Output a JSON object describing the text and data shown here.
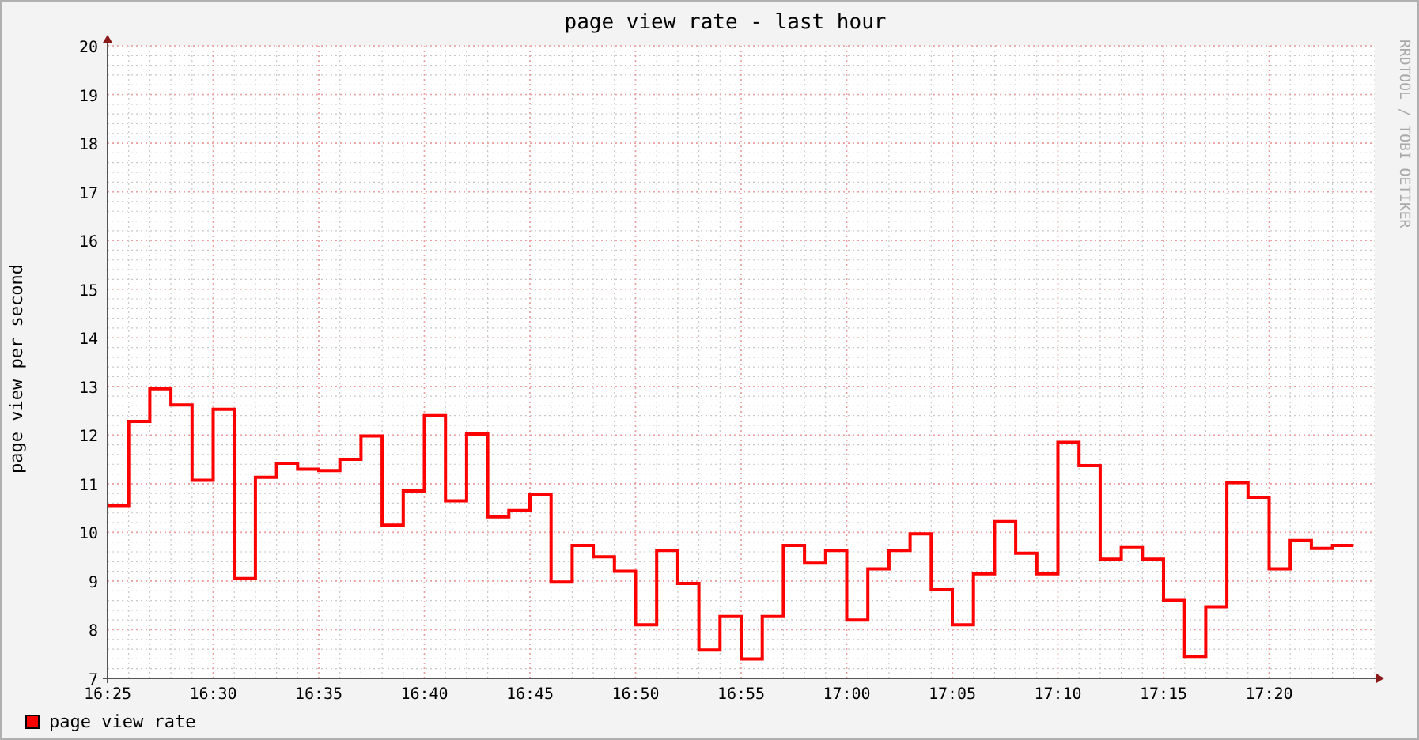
{
  "chart": {
    "chart_data": {
      "type": "line",
      "title": "page view rate - last hour",
      "ylabel": "page view per second",
      "x": [
        985,
        986,
        986,
        987,
        987,
        988,
        988,
        989,
        989,
        990,
        990,
        991,
        991,
        992,
        992,
        993,
        993,
        994,
        994,
        995,
        995,
        996,
        996,
        997,
        997,
        998,
        998,
        999,
        999,
        1000,
        1000,
        1001,
        1001,
        1002,
        1002,
        1003,
        1003,
        1004,
        1004,
        1005,
        1005,
        1006,
        1006,
        1007,
        1007,
        1008,
        1008,
        1009,
        1009,
        1010,
        1010,
        1011,
        1011,
        1012,
        1012,
        1013,
        1013,
        1014,
        1014,
        1015,
        1015,
        1016,
        1016,
        1017,
        1017,
        1018,
        1018,
        1019,
        1019,
        1020,
        1020,
        1021,
        1021,
        1022,
        1022,
        1023,
        1023,
        1024,
        1024,
        1025,
        1025,
        1026,
        1026,
        1027,
        1027,
        1028,
        1028,
        1029,
        1029,
        1030,
        1030,
        1031,
        1031,
        1032,
        1032,
        1033,
        1033,
        1034,
        1034,
        1035,
        1035,
        1036,
        1036,
        1037,
        1037,
        1038,
        1038,
        1039,
        1039,
        1040,
        1040,
        1041,
        1041,
        1042,
        1042,
        1043,
        1043,
        1044
      ],
      "series": [
        {
          "name": "page view rate",
          "color": "#ff0000",
          "values": [
            10.55,
            10.55,
            12.28,
            12.28,
            12.95,
            12.95,
            12.62,
            12.62,
            11.07,
            11.07,
            12.53,
            12.53,
            9.05,
            9.05,
            11.13,
            11.13,
            11.42,
            11.42,
            11.3,
            11.3,
            11.27,
            11.27,
            11.5,
            11.5,
            11.98,
            11.98,
            10.15,
            10.15,
            10.85,
            10.85,
            12.4,
            12.4,
            10.65,
            10.65,
            12.02,
            12.02,
            10.32,
            10.32,
            10.45,
            10.45,
            10.77,
            10.77,
            8.98,
            8.98,
            9.73,
            9.73,
            9.5,
            9.5,
            9.2,
            9.2,
            8.1,
            8.1,
            9.63,
            9.63,
            8.95,
            8.95,
            7.58,
            7.58,
            8.27,
            8.27,
            7.4,
            7.4,
            8.27,
            8.27,
            9.73,
            9.73,
            9.37,
            9.37,
            9.63,
            9.63,
            8.2,
            8.2,
            9.25,
            9.25,
            9.63,
            9.63,
            9.97,
            9.97,
            8.82,
            8.82,
            8.1,
            8.1,
            9.15,
            9.15,
            10.22,
            10.22,
            9.57,
            9.57,
            9.15,
            9.15,
            11.85,
            11.85,
            11.37,
            11.37,
            9.45,
            9.45,
            9.7,
            9.7,
            9.45,
            9.45,
            8.6,
            8.6,
            7.45,
            7.45,
            8.47,
            8.47,
            11.02,
            11.02,
            10.72,
            10.72,
            9.25,
            9.25,
            9.83,
            9.83,
            9.67,
            9.67,
            9.73,
            9.73
          ]
        }
      ],
      "xlim": [
        985,
        1045
      ],
      "xticks": [
        {
          "value": 985,
          "label": "16:25"
        },
        {
          "value": 990,
          "label": "16:30"
        },
        {
          "value": 995,
          "label": "16:35"
        },
        {
          "value": 1000,
          "label": "16:40"
        },
        {
          "value": 1005,
          "label": "16:45"
        },
        {
          "value": 1010,
          "label": "16:50"
        },
        {
          "value": 1015,
          "label": "16:55"
        },
        {
          "value": 1020,
          "label": "17:00"
        },
        {
          "value": 1025,
          "label": "17:05"
        },
        {
          "value": 1030,
          "label": "17:10"
        },
        {
          "value": 1035,
          "label": "17:15"
        },
        {
          "value": 1040,
          "label": "17:20"
        }
      ],
      "ylim": [
        7,
        20
      ],
      "grid": true,
      "yticks": [
        7,
        8,
        9,
        10,
        11,
        12,
        13,
        14,
        15,
        16,
        17,
        18,
        19,
        20
      ]
    }
  },
  "credit": "RRDTOOL / TOBI OETIKER"
}
